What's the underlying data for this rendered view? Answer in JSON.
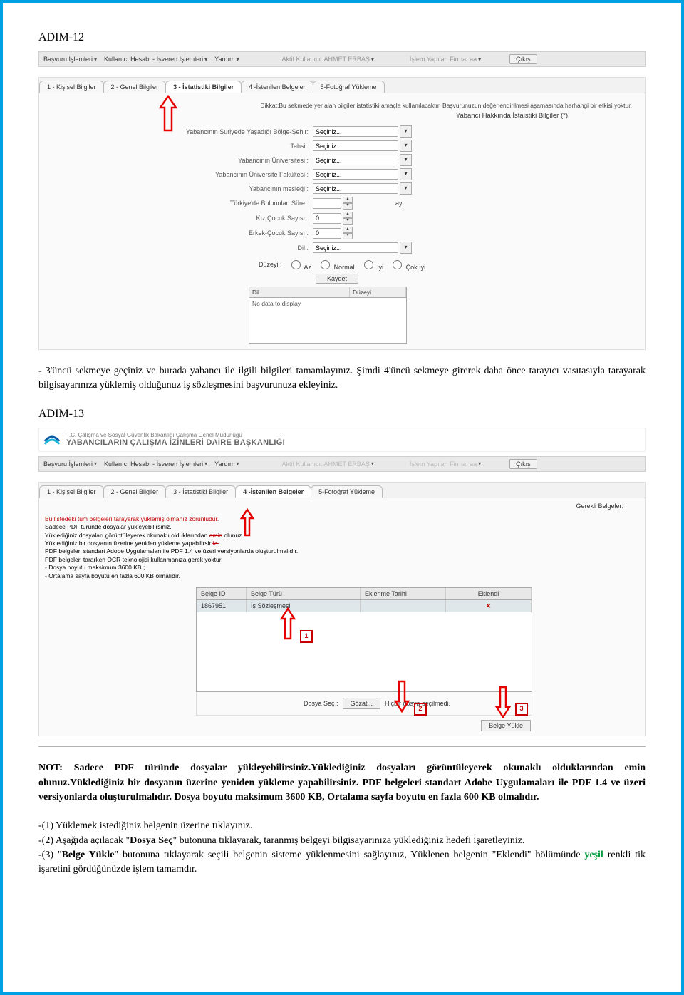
{
  "step12": {
    "heading": "ADIM-12",
    "menu": {
      "m1": "Başvuru İşlemleri",
      "m2": "Kullanıcı Hesabı - İşveren İşlemleri",
      "m3": "Yardım",
      "user_label": "Aktif Kullanıcı: AHMET ERBAŞ",
      "firm_label": "İşlem Yapılan Firma: aa",
      "exit": "Çıkış"
    },
    "tabs": {
      "t1": "1 - Kişisel Bilgiler",
      "t2": "2 - Genel Bilgiler",
      "t3": "3 - İstatistiki Bilgiler",
      "t4": "4 -İstenilen Belgeler",
      "t5": "5-Fotoğraf Yükleme"
    },
    "note": "Dikkat:Bu sekmede yer alan bilgiler istatistiki amaçla kullanılacaktır. Başvurunuzun değerlendirilmesi aşamasında herhangi bir etkisi yoktur.",
    "section_title": "Yabancı Hakkında İstaistiki Bilgiler (*)",
    "labels": {
      "l1": "Yabancının Suriyede Yaşadığı Bölge-Şehir:",
      "l2": "Tahsil:",
      "l3": "Yabancının Üniversitesi :",
      "l4": "Yabancının Üniversite Fakültesi :",
      "l5": "Yabancının mesleği :",
      "l6": "Türkiye'de Bulunulan Süre :",
      "l7": "Kız Çocuk Sayısı :",
      "l8": "Erkek-Çocuk Sayısı :",
      "l9": "Dil :"
    },
    "placeholder": "Seçiniz...",
    "zero": "0",
    "ay": "ay",
    "duzey": {
      "label": "Düzeyi :",
      "o1": "Az",
      "o2": "Normal",
      "o3": "İyi",
      "o4": "Çok İyi",
      "save": "Kaydet"
    },
    "table": {
      "h1": "Dil",
      "h2": "Düzeyi",
      "empty": "No data to display."
    },
    "para": "- 3'üncü sekmeye geçiniz ve burada yabancı ile ilgili bilgileri tamamlayınız. Şimdi 4'üncü sekmeye girerek daha önce tarayıcı vasıtasıyla tarayarak bilgisayarınıza yüklemiş olduğunuz iş sözleşmesini başvurunuza ekleyiniz."
  },
  "step13": {
    "heading": "ADIM-13",
    "ministry": {
      "line1": "T.C. Çalışma ve Sosyal Güvenlik Bakanlığı Çalışma Genel Müdürlüğü",
      "line2": "YABANCILARIN ÇALIŞMA İZİNLERİ DAİRE BAŞKANLIĞI"
    },
    "gerekli": "Gerekli Belgeler:",
    "notes": {
      "l1": "Bu listedeki tüm belgeleri tarayarak yüklemiş olmanız zorunludur.",
      "l2": "Sadece PDF türünde dosyalar yükleyebilirsiniz.",
      "l3a": "Yüklediğiniz dosyaları görüntüleyerek okunaklı olduklarından ",
      "l3b": "emin",
      "l3c": " olunuz.",
      "l4a": "Yüklediğiniz bir dosyanın üzerine yeniden yükleme yapabilirsin",
      "l4b": "iz.",
      "l5": "PDF belgeleri standart Adobe Uygulamaları ile PDF 1.4 ve üzeri versiyonlarda oluşturulmalıdır.",
      "l6": "PDF belgeleri tararken OCR teknolojisi kullanmanıza gerek yoktur.",
      "l7": "- Dosya boyutu maksimum 3600 KB ;",
      "l8": "- Ortalama sayfa boyutu en fazla 600 KB olmalıdır."
    },
    "dtable": {
      "h1": "Belge ID",
      "h2": "Belge Türü",
      "h3": "Eklenme Tarihi",
      "h4": "Eklendi",
      "r1c1": "1867951",
      "r1c2": "İş Sözleşmesi"
    },
    "file": {
      "label": "Dosya Seç :",
      "browse": "Gözat...",
      "none": "Hiçbir dosya seçilmedi.",
      "upload": "Belge Yükle"
    },
    "nums": {
      "n1": "1",
      "n2": "2",
      "n3": "3"
    },
    "note_intro": "NOT:",
    "note_body": " Sadece PDF türünde dosyalar yükleyebilirsiniz.Yüklediğiniz dosyaları görüntüleyerek okunaklı olduklarından emin olunuz.Yüklediğiniz bir dosyanın üzerine yeniden yükleme yapabilirsiniz. PDF belgeleri standart Adobe Uygulamaları ile PDF 1.4 ve üzeri versiyonlarda oluşturulmalıdır. Dosya boyutu maksimum 3600 KB, Ortalama sayfa boyutu en fazla 600 KB olmalıdır.",
    "bullets": {
      "b1": "-(1) Yüklemek istediğiniz belgenin üzerine tıklayınız.",
      "b2a": "-(2) Aşağıda açılacak \"",
      "b2b": "Dosya Seç",
      "b2c": "\" butonuna tıklayarak, taranmış belgeyi bilgisayarınıza yüklediğiniz hedefi işaretleyiniz.",
      "b3a": "-(3) \"",
      "b3b": "Belge Yükle",
      "b3c": "\" butonuna tıklayarak seçili belgenin sisteme yüklenmesini sağlayınız, Yüklenen belgenin \"Eklendi\" bölümünde ",
      "b3d": "yeşil",
      "b3e": " renkli tik işaretini gördüğünüzde işlem tamamdır."
    }
  }
}
